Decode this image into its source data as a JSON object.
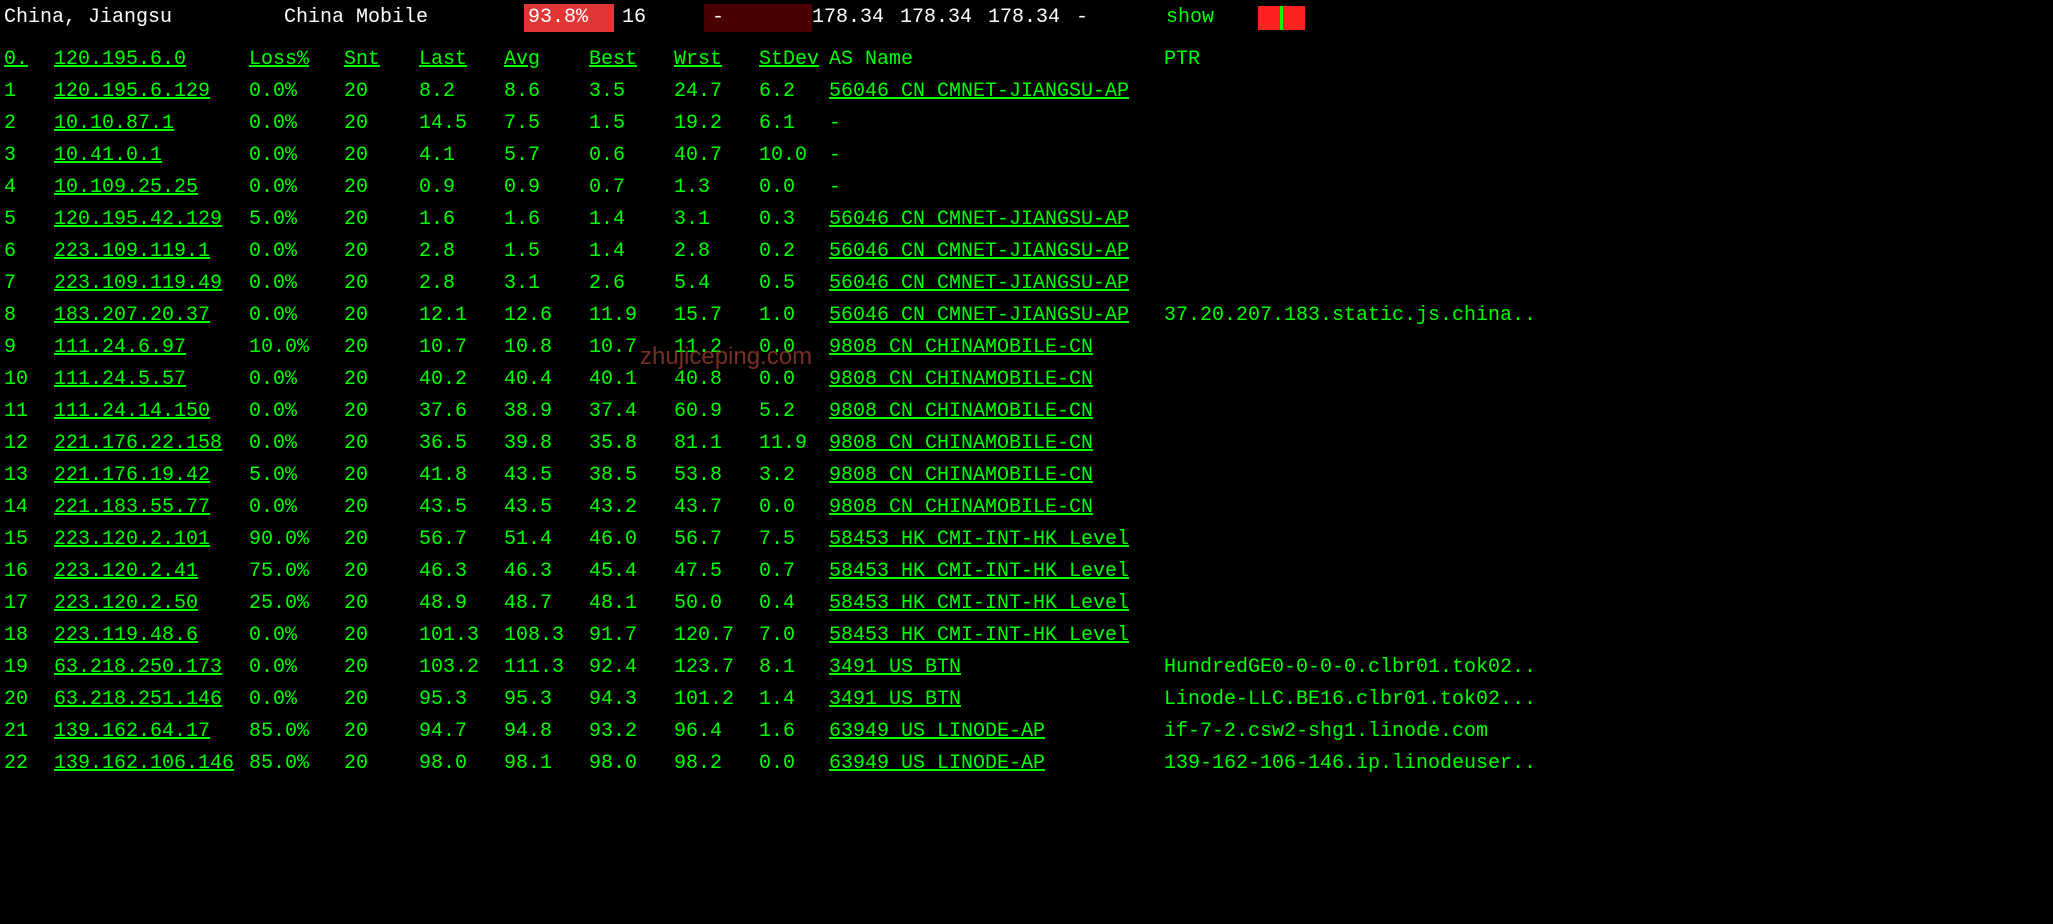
{
  "header": {
    "location": "China, Jiangsu",
    "carrier": "China Mobile",
    "pct": "93.8%",
    "count": "16",
    "dash1": "-",
    "n1": "178.34",
    "n2": "178.34",
    "n3": "178.34",
    "dash2": "-",
    "show": "show"
  },
  "columns": {
    "hop": "0.",
    "ip": "120.195.6.0",
    "loss": "Loss%",
    "snt": "Snt",
    "last": "Last",
    "avg": "Avg",
    "best": "Best",
    "wrst": "Wrst",
    "stdev": "StDev",
    "as": "AS Name",
    "ptr": "PTR"
  },
  "rows": [
    {
      "hop": "1",
      "ip": "120.195.6.129",
      "loss": "0.0%",
      "snt": "20",
      "last": "8.2",
      "avg": "8.6",
      "best": "3.5",
      "wrst": "24.7",
      "stdev": "6.2",
      "as": "56046 CN CMNET-JIANGSU-AP",
      "asu": true,
      "ptr": ""
    },
    {
      "hop": "2",
      "ip": "10.10.87.1",
      "loss": "0.0%",
      "snt": "20",
      "last": "14.5",
      "avg": "7.5",
      "best": "1.5",
      "wrst": "19.2",
      "stdev": "6.1",
      "as": "-",
      "asu": false,
      "ptr": ""
    },
    {
      "hop": "3",
      "ip": "10.41.0.1",
      "loss": "0.0%",
      "snt": "20",
      "last": "4.1",
      "avg": "5.7",
      "best": "0.6",
      "wrst": "40.7",
      "stdev": "10.0",
      "as": "-",
      "asu": false,
      "ptr": ""
    },
    {
      "hop": "4",
      "ip": "10.109.25.25",
      "loss": "0.0%",
      "snt": "20",
      "last": "0.9",
      "avg": "0.9",
      "best": "0.7",
      "wrst": "1.3",
      "stdev": "0.0",
      "as": "-",
      "asu": false,
      "ptr": ""
    },
    {
      "hop": "5",
      "ip": "120.195.42.129",
      "loss": "5.0%",
      "snt": "20",
      "last": "1.6",
      "avg": "1.6",
      "best": "1.4",
      "wrst": "3.1",
      "stdev": "0.3",
      "as": "56046 CN CMNET-JIANGSU-AP",
      "asu": true,
      "ptr": ""
    },
    {
      "hop": "6",
      "ip": "223.109.119.1",
      "loss": "0.0%",
      "snt": "20",
      "last": "2.8",
      "avg": "1.5",
      "best": "1.4",
      "wrst": "2.8",
      "stdev": "0.2",
      "as": "56046 CN CMNET-JIANGSU-AP",
      "asu": true,
      "ptr": ""
    },
    {
      "hop": "7",
      "ip": "223.109.119.49",
      "loss": "0.0%",
      "snt": "20",
      "last": "2.8",
      "avg": "3.1",
      "best": "2.6",
      "wrst": "5.4",
      "stdev": "0.5",
      "as": "56046 CN CMNET-JIANGSU-AP",
      "asu": true,
      "ptr": ""
    },
    {
      "hop": "8",
      "ip": "183.207.20.37",
      "loss": "0.0%",
      "snt": "20",
      "last": "12.1",
      "avg": "12.6",
      "best": "11.9",
      "wrst": "15.7",
      "stdev": "1.0",
      "as": "56046 CN CMNET-JIANGSU-AP",
      "asu": true,
      "ptr": "37.20.207.183.static.js.china.."
    },
    {
      "hop": "9",
      "ip": "111.24.6.97",
      "loss": "10.0%",
      "snt": "20",
      "last": "10.7",
      "avg": "10.8",
      "best": "10.7",
      "wrst": "11.2",
      "stdev": "0.0",
      "as": "9808  CN CHINAMOBILE-CN",
      "asu": true,
      "ptr": ""
    },
    {
      "hop": "10",
      "ip": "111.24.5.57",
      "loss": "0.0%",
      "snt": "20",
      "last": "40.2",
      "avg": "40.4",
      "best": "40.1",
      "wrst": "40.8",
      "stdev": "0.0",
      "as": "9808  CN CHINAMOBILE-CN",
      "asu": true,
      "ptr": ""
    },
    {
      "hop": "11",
      "ip": "111.24.14.150",
      "loss": "0.0%",
      "snt": "20",
      "last": "37.6",
      "avg": "38.9",
      "best": "37.4",
      "wrst": "60.9",
      "stdev": "5.2",
      "as": "9808  CN CHINAMOBILE-CN",
      "asu": true,
      "ptr": ""
    },
    {
      "hop": "12",
      "ip": "221.176.22.158",
      "loss": "0.0%",
      "snt": "20",
      "last": "36.5",
      "avg": "39.8",
      "best": "35.8",
      "wrst": "81.1",
      "stdev": "11.9",
      "as": "9808  CN CHINAMOBILE-CN",
      "asu": true,
      "ptr": ""
    },
    {
      "hop": "13",
      "ip": "221.176.19.42",
      "loss": "5.0%",
      "snt": "20",
      "last": "41.8",
      "avg": "43.5",
      "best": "38.5",
      "wrst": "53.8",
      "stdev": "3.2",
      "as": "9808  CN CHINAMOBILE-CN",
      "asu": true,
      "ptr": ""
    },
    {
      "hop": "14",
      "ip": "221.183.55.77",
      "loss": "0.0%",
      "snt": "20",
      "last": "43.5",
      "avg": "43.5",
      "best": "43.2",
      "wrst": "43.7",
      "stdev": "0.0",
      "as": "9808  CN CHINAMOBILE-CN",
      "asu": true,
      "ptr": ""
    },
    {
      "hop": "15",
      "ip": "223.120.2.101",
      "loss": "90.0%",
      "snt": "20",
      "last": "56.7",
      "avg": "51.4",
      "best": "46.0",
      "wrst": "56.7",
      "stdev": "7.5",
      "as": "58453 HK CMI-INT-HK Level",
      "asu": true,
      "ptr": ""
    },
    {
      "hop": "16",
      "ip": "223.120.2.41",
      "loss": "75.0%",
      "snt": "20",
      "last": "46.3",
      "avg": "46.3",
      "best": "45.4",
      "wrst": "47.5",
      "stdev": "0.7",
      "as": "58453 HK CMI-INT-HK Level",
      "asu": true,
      "ptr": ""
    },
    {
      "hop": "17",
      "ip": "223.120.2.50",
      "loss": "25.0%",
      "snt": "20",
      "last": "48.9",
      "avg": "48.7",
      "best": "48.1",
      "wrst": "50.0",
      "stdev": "0.4",
      "as": "58453 HK CMI-INT-HK Level",
      "asu": true,
      "ptr": ""
    },
    {
      "hop": "18",
      "ip": "223.119.48.6",
      "loss": "0.0%",
      "snt": "20",
      "last": "101.3",
      "avg": "108.3",
      "best": "91.7",
      "wrst": "120.7",
      "stdev": "7.0",
      "as": "58453 HK CMI-INT-HK Level",
      "asu": true,
      "ptr": ""
    },
    {
      "hop": "19",
      "ip": "63.218.250.173",
      "loss": "0.0%",
      "snt": "20",
      "last": "103.2",
      "avg": "111.3",
      "best": "92.4",
      "wrst": "123.7",
      "stdev": "8.1",
      "as": "3491  US BTN",
      "asu": true,
      "ptr": "HundredGE0-0-0-0.clbr01.tok02.."
    },
    {
      "hop": "20",
      "ip": "63.218.251.146",
      "loss": "0.0%",
      "snt": "20",
      "last": "95.3",
      "avg": "95.3",
      "best": "94.3",
      "wrst": "101.2",
      "stdev": "1.4",
      "as": "3491  US BTN",
      "asu": true,
      "ptr": "Linode-LLC.BE16.clbr01.tok02..."
    },
    {
      "hop": "21",
      "ip": "139.162.64.17",
      "loss": "85.0%",
      "snt": "20",
      "last": "94.7",
      "avg": "94.8",
      "best": "93.2",
      "wrst": "96.4",
      "stdev": "1.6",
      "as": "63949 US LINODE-AP",
      "asu": true,
      "ptr": "if-7-2.csw2-shg1.linode.com"
    },
    {
      "hop": "22",
      "ip": "139.162.106.146",
      "loss": "85.0%",
      "snt": "20",
      "last": "98.0",
      "avg": "98.1",
      "best": "98.0",
      "wrst": "98.2",
      "stdev": "0.0",
      "as": "63949 US LINODE-AP",
      "asu": true,
      "ptr": "139-162-106-146.ip.linodeuser.."
    }
  ],
  "watermark": "zhujiceping.com"
}
